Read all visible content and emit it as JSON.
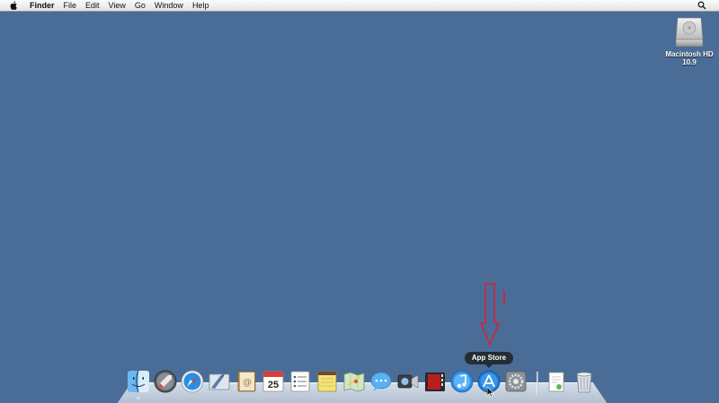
{
  "menubar": {
    "apple_icon": "apple-icon",
    "app_name": "Finder",
    "items": [
      "File",
      "Edit",
      "View",
      "Go",
      "Window",
      "Help"
    ],
    "right_icon": "spotlight-search-icon"
  },
  "desktop": {
    "background_color": "#4a6d98",
    "disk": {
      "icon": "hard-drive-icon",
      "name_line1": "Macintosh HD",
      "name_line2": "10.9"
    }
  },
  "dock": {
    "tooltip": "App Store",
    "items": [
      {
        "name": "finder",
        "icon": "finder-icon"
      },
      {
        "name": "launchpad",
        "icon": "launchpad-icon"
      },
      {
        "name": "safari",
        "icon": "safari-icon"
      },
      {
        "name": "mail",
        "icon": "mail-icon"
      },
      {
        "name": "contacts",
        "icon": "contacts-icon"
      },
      {
        "name": "calendar",
        "icon": "calendar-icon",
        "label": "25"
      },
      {
        "name": "reminders",
        "icon": "reminders-icon"
      },
      {
        "name": "notes",
        "icon": "notes-icon"
      },
      {
        "name": "maps",
        "icon": "maps-icon"
      },
      {
        "name": "messages",
        "icon": "messages-icon"
      },
      {
        "name": "facetime",
        "icon": "facetime-icon"
      },
      {
        "name": "photo-booth",
        "icon": "photo-booth-icon"
      },
      {
        "name": "itunes",
        "icon": "itunes-icon"
      },
      {
        "name": "app-store",
        "icon": "app-store-icon"
      },
      {
        "name": "system-preferences",
        "icon": "system-preferences-icon"
      },
      {
        "name": "documents",
        "icon": "documents-stack-icon"
      },
      {
        "name": "trash",
        "icon": "trash-icon"
      }
    ]
  },
  "annotation": {
    "color": "#d3213a",
    "arrow_icon": "red-arrow-down-icon"
  }
}
